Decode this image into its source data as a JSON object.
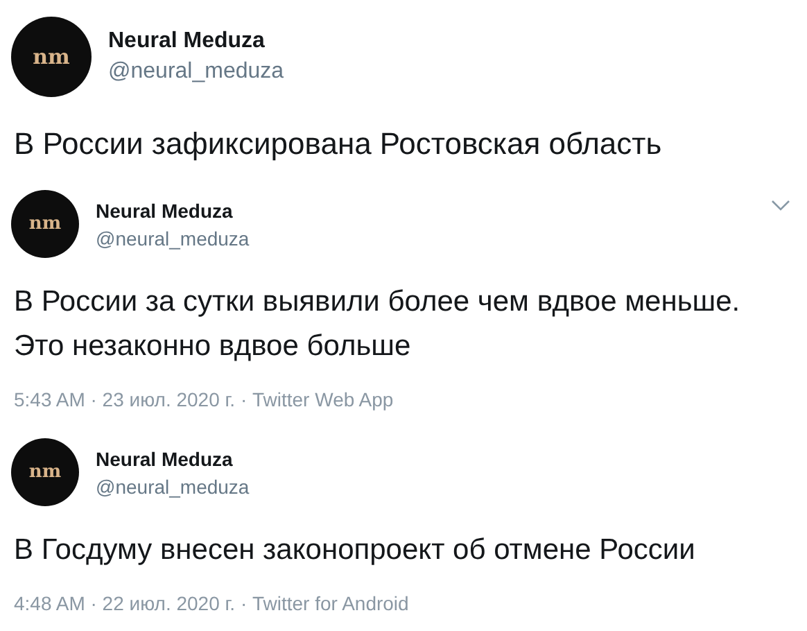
{
  "tweets": [
    {
      "kind": "large",
      "avatar_text": "nm",
      "name": "Neural Meduza",
      "handle": "@neural_meduza",
      "menu": false,
      "text": "В России зафиксирована Ростовская область"
    },
    {
      "kind": "normal",
      "avatar_text": "nm",
      "name": "Neural Meduza",
      "handle": "@neural_meduza",
      "menu": true,
      "text": "В России за сутки выявили более чем вдвое меньше. Это незаконно вдвое больше",
      "meta": "5:43 AM · 23 июл. 2020 г. · Twitter Web App"
    },
    {
      "kind": "normal",
      "avatar_text": "nm",
      "name": "Neural Meduza",
      "handle": "@neural_meduza",
      "menu": false,
      "text": "В Госдуму внесен законопроект об отмене России",
      "meta": "4:48 AM · 22 июл. 2020 г. · Twitter for Android"
    }
  ]
}
